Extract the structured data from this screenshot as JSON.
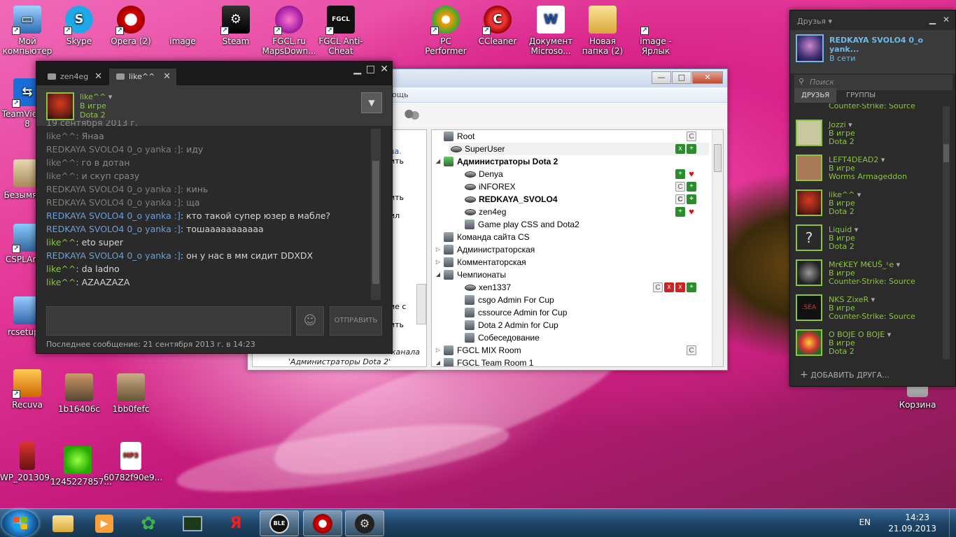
{
  "desktop_icons": [
    {
      "label": "Мой компьютер",
      "icon": "computer-icon"
    },
    {
      "label": "Skype",
      "icon": "skype-icon"
    },
    {
      "label": "Opera (2)",
      "icon": "opera-icon"
    },
    {
      "label": "image",
      "icon": "image-icon"
    },
    {
      "label": "Steam",
      "icon": "steam-icon"
    },
    {
      "label": "FGCL.ru MapsDown...",
      "icon": "fgcl-maps-icon"
    },
    {
      "label": "FGCL Anti-Cheat",
      "icon": "fgcl-anticheat-icon"
    },
    {
      "label": "PC Performer",
      "icon": "pc-performer-icon"
    },
    {
      "label": "CCleaner",
      "icon": "ccleaner-icon"
    },
    {
      "label": "Документ Microso...",
      "icon": "word-document-icon"
    },
    {
      "label": "Новая папка (2)",
      "icon": "folder-icon"
    },
    {
      "label": "image - Ярлык",
      "icon": "image-shortcut-icon"
    },
    {
      "label": "TeamViewer 8",
      "icon": "teamviewer-icon"
    },
    {
      "label": "Безымян...",
      "icon": "untitled-image-icon"
    },
    {
      "label": "CSPLAnt...",
      "icon": "csplant-icon"
    },
    {
      "label": "rcsetup...",
      "icon": "rcsetup-icon"
    },
    {
      "label": "Recuva",
      "icon": "recuva-icon"
    },
    {
      "label": "1b16406c",
      "icon": "photo-icon"
    },
    {
      "label": "1bb0fefc",
      "icon": "photo-icon"
    },
    {
      "label": "WP_201309...",
      "icon": "photo-icon"
    },
    {
      "label": "1245227857...",
      "icon": "photo-icon"
    },
    {
      "label": "60782f90e9...",
      "icon": "mp3-file-icon"
    },
    {
      "label": "Корзина",
      "icon": "recycle-bin-icon"
    }
  ],
  "chat": {
    "tabs": [
      {
        "label": "zen4eg"
      },
      {
        "label": "like^^"
      }
    ],
    "friend": {
      "name": "like^^",
      "status": "В игре",
      "game": "Dota 2"
    },
    "messages": [
      {
        "name": "",
        "text": "19 сентября 2013 г.",
        "style": "read"
      },
      {
        "name": "like^^",
        "text": ": Янаа",
        "style": "read"
      },
      {
        "name": "REDKAYA SVOLO4 0_o yanka :]",
        "text": ": иду",
        "style": "read"
      },
      {
        "name": "like^^",
        "text": ": го в дотан",
        "style": "read"
      },
      {
        "name": "like^^",
        "text": ": и скуп сразу",
        "style": "read"
      },
      {
        "name": "REDKAYA SVOLO4 0_o yanka :]",
        "text": ": кинь",
        "style": "read"
      },
      {
        "name": "REDKAYA SVOLO4 0_o yanka :]",
        "text": ": ща",
        "style": "read"
      },
      {
        "name": "REDKAYA SVOLO4 0_o yanka :]",
        "text": ": кто такой супер юзер в мабле?",
        "style": "new-me"
      },
      {
        "name": "REDKAYA SVOLO4 0_o yanka :]",
        "text": ": тошааааааааааа",
        "style": "new-me"
      },
      {
        "name": "like^^",
        "text": ": eto super",
        "style": "new-him"
      },
      {
        "name": "REDKAYA SVOLO4 0_o yanka :]",
        "text": ": он у нас в мм сидит DDXDX",
        "style": "new-me"
      },
      {
        "name": "like^^",
        "text": ": da ladno",
        "style": "new-him"
      },
      {
        "name": "like^^",
        "text": ": AZAAZAZA",
        "style": "new-him"
      }
    ],
    "send_label": "ОТПРАВИТЬ",
    "footer": "Последнее сообщение: 21 сентября 2013 г. в 14:23"
  },
  "teamspeak": {
    "menu_visible": "ощь",
    "left_snippets": [
      "ва.",
      "ить",
      "ить",
      "ил",
      "ие с",
      "ить"
    ],
    "hint": "Нажмите для подключения к каналу 'Администраторы Dota 2'",
    "hint_line1": "канала",
    "hint_line2": "'Администраторы Dota 2'",
    "tree": [
      {
        "label": "Root",
        "type": "channel",
        "level": 0,
        "badges": [
          "C"
        ]
      },
      {
        "label": "SuperUser",
        "type": "user",
        "level": 1,
        "badges": [
          "mute",
          "add"
        ],
        "selected": true
      },
      {
        "label": "Администраторы Dota 2",
        "type": "channel",
        "level": 0,
        "bold": true,
        "expanded": true
      },
      {
        "label": "Denya",
        "type": "user",
        "level": 2,
        "badges": [
          "add",
          "heart"
        ]
      },
      {
        "label": "iNFOREX",
        "type": "user",
        "level": 2,
        "badges": [
          "C",
          "add"
        ]
      },
      {
        "label": "REDKAYA_SVOLO4",
        "type": "user",
        "level": 2,
        "bold": true,
        "badges": [
          "C",
          "add"
        ]
      },
      {
        "label": "zen4eg",
        "type": "user",
        "level": 2,
        "badges": [
          "add",
          "heart"
        ]
      },
      {
        "label": "Game play CSS and Dota2",
        "type": "channel",
        "level": 2
      },
      {
        "label": "Команда сайта CS",
        "type": "channel",
        "level": 0
      },
      {
        "label": "Администраторская",
        "type": "channel",
        "level": 0,
        "collapsed": true
      },
      {
        "label": "Комментаторская",
        "type": "channel",
        "level": 0,
        "collapsed": true
      },
      {
        "label": "Чемпионаты",
        "type": "channel",
        "level": 0,
        "expanded": true
      },
      {
        "label": "xen1337",
        "type": "user",
        "level": 2,
        "badges": [
          "C",
          "mute",
          "mute",
          "add"
        ]
      },
      {
        "label": "csgo Admin For Cup",
        "type": "channel",
        "level": 2
      },
      {
        "label": "cssource Admin for Cup",
        "type": "channel",
        "level": 2
      },
      {
        "label": "Dota 2  Admin for Cup",
        "type": "channel",
        "level": 2
      },
      {
        "label": "Собеседование",
        "type": "channel",
        "level": 2
      },
      {
        "label": "FGCL MIX Room",
        "type": "channel",
        "level": 0,
        "collapsed": true,
        "badges": [
          "C"
        ]
      },
      {
        "label": "FGCL Team Room 1",
        "type": "channel",
        "level": 0,
        "expanded": true
      }
    ]
  },
  "friends": {
    "title": "Друзья",
    "me": {
      "name": "REDKAYA SVOLO4 0_o yank...",
      "status": "В сети"
    },
    "search_placeholder": "Поиск",
    "tabs": [
      {
        "label": "ДРУЗЬЯ"
      },
      {
        "label": "ГРУППЫ"
      }
    ],
    "partial_top": "Counter-Strike: Source",
    "list": [
      {
        "name": "Jozzi",
        "status": "В игре",
        "game": "Dota 2",
        "avatar": "#c8c8a0"
      },
      {
        "name": "LEFT4DEAD2",
        "status": "В игре",
        "game": "Worms Armageddon",
        "avatar": "#a87a58"
      },
      {
        "name": "like^^",
        "status": "В игре",
        "game": "Dota 2",
        "avatar": "#c0301c"
      },
      {
        "name": "Liquid",
        "status": "В игре",
        "game": "Dota 2",
        "avatar": "#2a2a2a"
      },
      {
        "name": "Mr€KEY M€UŠ_ᵋe",
        "status": "В игре",
        "game": "Counter-Strike: Source",
        "avatar": "#3a3a3a"
      },
      {
        "name": "NKS ZixeR",
        "status": "В игре",
        "game": "Counter-Strike: Source",
        "avatar": "#111111"
      },
      {
        "name": "O BOJE O BOJE",
        "status": "В игре",
        "game": "Dota 2",
        "avatar": "#c0a020"
      }
    ],
    "add_label": "ДОБАВИТЬ ДРУГА..."
  },
  "taskbar": {
    "lang": "EN",
    "time": "14:23",
    "date": "21.09.2013",
    "pinned": [
      "explorer-icon",
      "media-player-icon",
      "icq-icon",
      "task-manager-icon",
      "yandex-icon",
      "ble-icon",
      "opera-icon",
      "steam-icon"
    ]
  }
}
